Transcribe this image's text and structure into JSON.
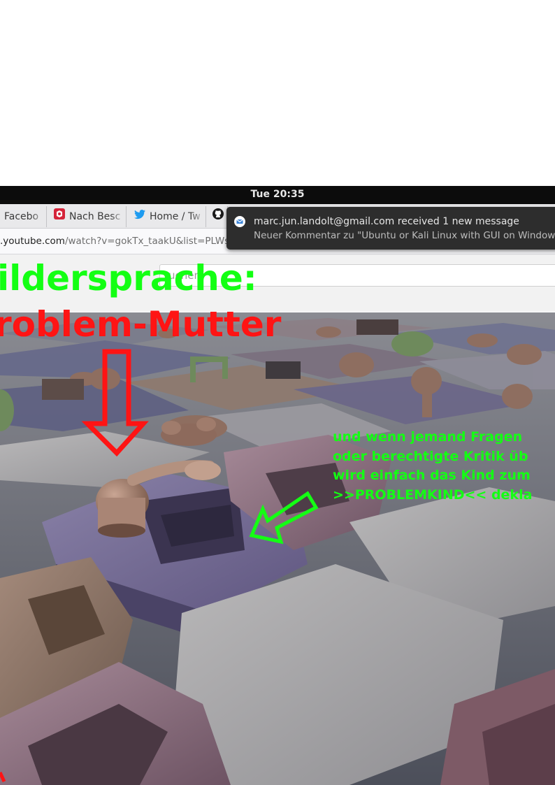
{
  "system_bar": {
    "clock": "Tue 20:35"
  },
  "browser": {
    "tabs": [
      {
        "label": "Facebo",
        "icon": "facebook-icon"
      },
      {
        "label": "Nach Besc",
        "icon": "bookmark-icon"
      },
      {
        "label": "Home / Tw",
        "icon": "twitter-icon"
      },
      {
        "label": "",
        "icon": "github-icon"
      }
    ],
    "url": {
      "host": ".youtube.com",
      "path": "/watch?v=gokTx_taakU&list=PLWs"
    },
    "page_search": {
      "partial_text": "uchen"
    }
  },
  "notification": {
    "icon": "mail-icon",
    "title": "marc.jun.landolt@gmail.com received 1 new message",
    "body": "Neuer Kommentar zu \"Ubuntu or Kali Linux with GUI on Windows w"
  },
  "overlay": {
    "green_heading": "ildersprache:",
    "red_heading": "roblem-Mutter",
    "annotation_lines": [
      "und wenn jemand Fragen",
      "oder berechtigte Kritik üb",
      "wird einfach das Kind zum",
      ">>PROBLEMKIND<< dekla"
    ]
  },
  "colors": {
    "overlay_green": "#13ff13",
    "overlay_red": "#ff1414",
    "topbar": "#0c0c0c",
    "notification_bg": "#2d2d2d"
  }
}
